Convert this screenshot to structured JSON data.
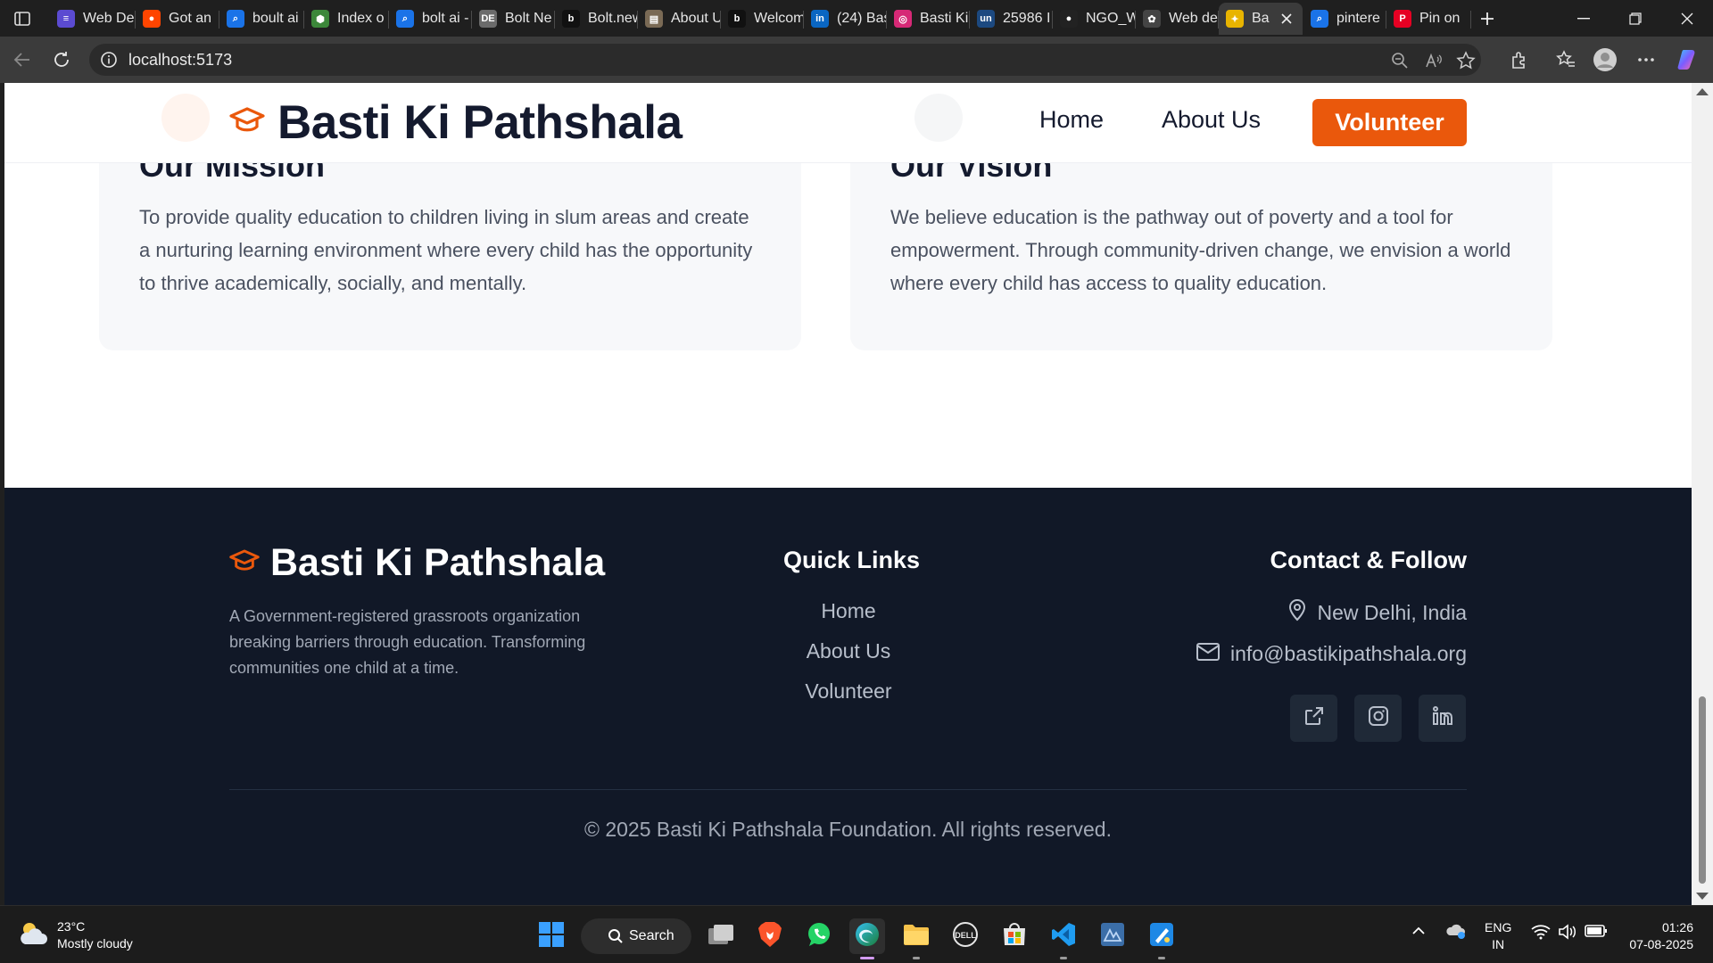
{
  "browser": {
    "tabs": [
      {
        "label": "Web De",
        "favicon": "list-icon",
        "color": "#5b4bd1"
      },
      {
        "label": "Got an",
        "favicon": "reddit-icon",
        "color": "#ff4500"
      },
      {
        "label": "boult ai",
        "favicon": "search-icon",
        "color": "#1a73e8"
      },
      {
        "label": "Index o",
        "favicon": "node-icon",
        "color": "#3c873a"
      },
      {
        "label": "bolt ai -",
        "favicon": "search-icon",
        "color": "#1a73e8"
      },
      {
        "label": "Bolt Ne",
        "favicon": "dev-icon",
        "color": "#6b6b6b"
      },
      {
        "label": "Bolt.new",
        "favicon": "bolt-icon",
        "color": "#111111"
      },
      {
        "label": "About U",
        "favicon": "page-icon",
        "color": "#7a6a55"
      },
      {
        "label": "Welcom",
        "favicon": "bolt-icon",
        "color": "#111111"
      },
      {
        "label": "(24) Bas",
        "favicon": "linkedin-icon",
        "color": "#0a66c2"
      },
      {
        "label": "Basti Ki",
        "favicon": "instagram-icon",
        "color": "#d62976"
      },
      {
        "label": "25986 I",
        "favicon": "unstop-icon",
        "color": "#1c4980"
      },
      {
        "label": "NGO_W",
        "favicon": "github-icon",
        "color": "#222222"
      },
      {
        "label": "Web de",
        "favicon": "openai-icon",
        "color": "#444444"
      },
      {
        "label": "Ba",
        "favicon": "site-icon",
        "color": "#e8b400"
      },
      {
        "label": "pintere",
        "favicon": "search-icon",
        "color": "#1a73e8"
      },
      {
        "label": "Pin on",
        "favicon": "pinterest-icon",
        "color": "#e60023"
      }
    ],
    "url": "localhost:5173"
  },
  "nav": {
    "brand": "Basti Ki Pathshala",
    "links": [
      "Home",
      "About Us"
    ],
    "cta": "Volunteer"
  },
  "cards": [
    {
      "title": "Our Mission",
      "text": "To provide quality education to children living in slum areas and create a nurturing learning environment where every child has the opportunity to thrive academically, socially, and mentally."
    },
    {
      "title": "Our Vision",
      "text": "We believe education is the pathway out of poverty and a tool for empowerment. Through community-driven change, we envision a world where every child has access to quality education."
    }
  ],
  "footer": {
    "brand": "Basti Ki Pathshala",
    "description": "A Government-registered grassroots organization breaking barriers through education. Transforming communities one child at a time.",
    "quick_links_title": "Quick Links",
    "quick_links": [
      "Home",
      "About Us",
      "Volunteer"
    ],
    "contact_title": "Contact & Follow",
    "location": "New Delhi, India",
    "email": "info@bastikipathshala.org",
    "socials": [
      "external-link-icon",
      "instagram-icon",
      "linkedin-icon"
    ],
    "copyright": "© 2025 Basti Ki Pathshala Foundation. All rights reserved."
  },
  "colors": {
    "accent": "#ea580c",
    "footer_bg": "#111827",
    "heading": "#141a2e"
  },
  "taskbar": {
    "weather": {
      "temp": "23°C",
      "condition": "Mostly cloudy"
    },
    "search_label": "Search",
    "lang": [
      "ENG",
      "IN"
    ],
    "time": "01:26",
    "date": "07-08-2025"
  }
}
